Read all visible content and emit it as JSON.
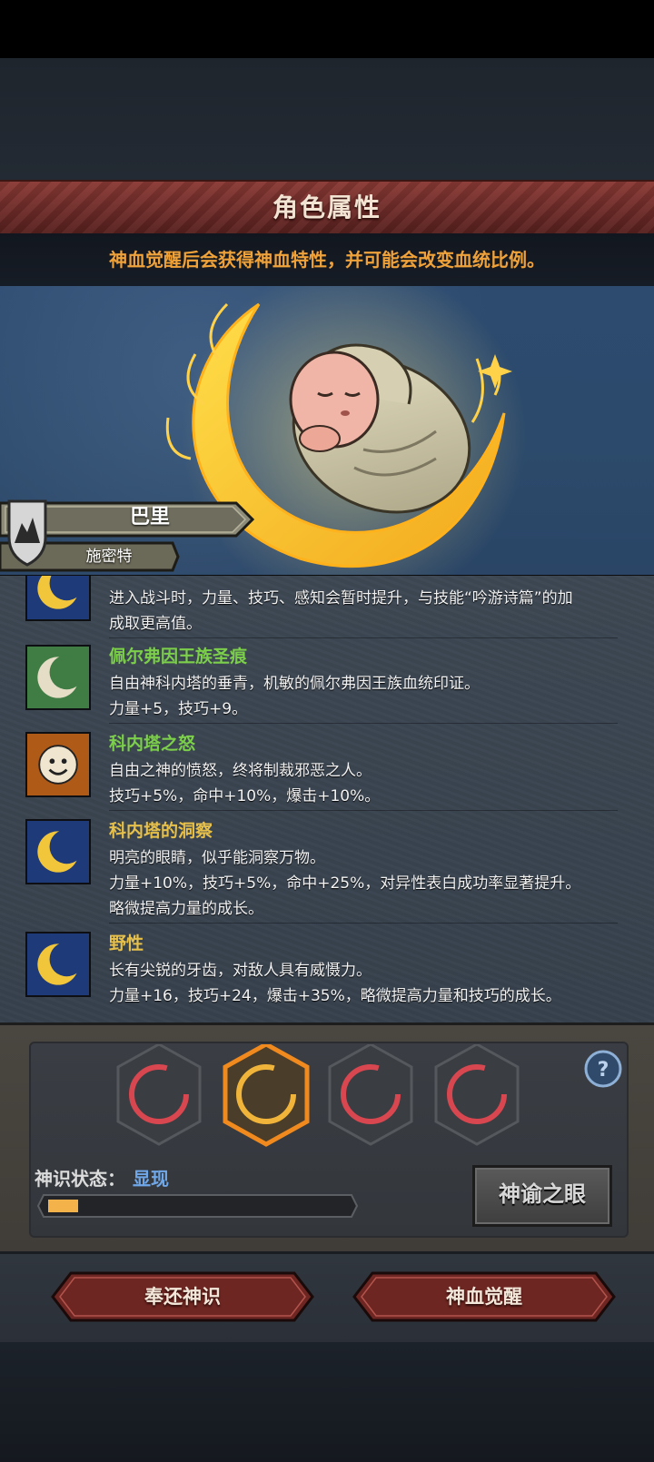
{
  "header": {
    "title": "角色属性"
  },
  "subtitle": "神血觉醒后会获得神血特性，并可能会改变血统比例。",
  "character": {
    "name": "巴里",
    "class": "施密特"
  },
  "traits": [
    {
      "name": "",
      "name_color": "#e6c04a",
      "icon": "golden-crescent-icon",
      "lines": [
        "进入战斗时，力量、技巧、感知会暂时提升，与技能“吟游诗篇”的加",
        "成取更高值。"
      ]
    },
    {
      "name": "佩尔弗因王族圣痕",
      "name_color": "#7ccf4a",
      "icon": "silver-crescent-icon",
      "lines": [
        "自由神科内塔的垂青，机敏的佩尔弗因王族血统印证。",
        "力量+5，技巧+9。"
      ]
    },
    {
      "name": "科内塔之怒",
      "name_color": "#7ccf4a",
      "icon": "angry-sun-icon",
      "lines": [
        "自由之神的愤怒，终将制裁邪恶之人。",
        "技巧+5%，命中+10%，爆击+10%。"
      ]
    },
    {
      "name": "科内塔的洞察",
      "name_color": "#e6c04a",
      "icon": "golden-crescent-icon",
      "lines": [
        "明亮的眼睛，似乎能洞察万物。",
        "力量+10%，技巧+5%，命中+25%，对异性表白成功率显著提升。",
        "略微提高力量的成长。"
      ]
    },
    {
      "name": "野性",
      "name_color": "#e6c04a",
      "icon": "golden-crescent-icon",
      "lines": [
        "长有尖锐的牙齿，对敌人具有威慑力。",
        "力量+16，技巧+24，爆击+35%，略微提高力量和技巧的成长。"
      ]
    }
  ],
  "divine_slots": [
    {
      "state": "inactive",
      "color": "#d8474f"
    },
    {
      "state": "selected",
      "color": "#f0b43a"
    },
    {
      "state": "inactive",
      "color": "#d8474f"
    },
    {
      "state": "inactive",
      "color": "#d8474f"
    }
  ],
  "status": {
    "label": "神识状态：",
    "value": "显现",
    "progress": 0.1
  },
  "buttons": {
    "oracle": "神谕之眼",
    "return": "奉还神识",
    "awaken": "神血觉醒"
  },
  "colors": {
    "header": "#7a322e",
    "accent": "#f0a23a",
    "status_value": "#6fa7e8"
  }
}
